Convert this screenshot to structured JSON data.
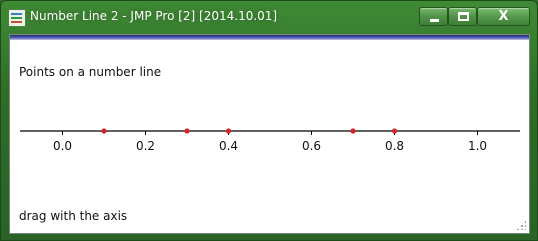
{
  "window": {
    "title": "Number Line 2 - JMP Pro [2] [2014.10.01]",
    "controls": {
      "minimize_icon": "minimize-icon",
      "maximize_icon": "maximize-icon",
      "close_label": "X"
    }
  },
  "content": {
    "heading": "Points on a number line",
    "footer": "drag with the axis"
  },
  "axis": {
    "min": -0.1,
    "max": 1.1,
    "ticks": [
      {
        "value": 0.0,
        "label": "0.0"
      },
      {
        "value": 0.2,
        "label": "0.2"
      },
      {
        "value": 0.4,
        "label": "0.4"
      },
      {
        "value": 0.6,
        "label": "0.6"
      },
      {
        "value": 0.8,
        "label": "0.8"
      },
      {
        "value": 1.0,
        "label": "1.0"
      }
    ],
    "points": [
      0.1,
      0.3,
      0.4,
      0.7,
      0.8
    ],
    "point_color": "#d6222c"
  }
}
